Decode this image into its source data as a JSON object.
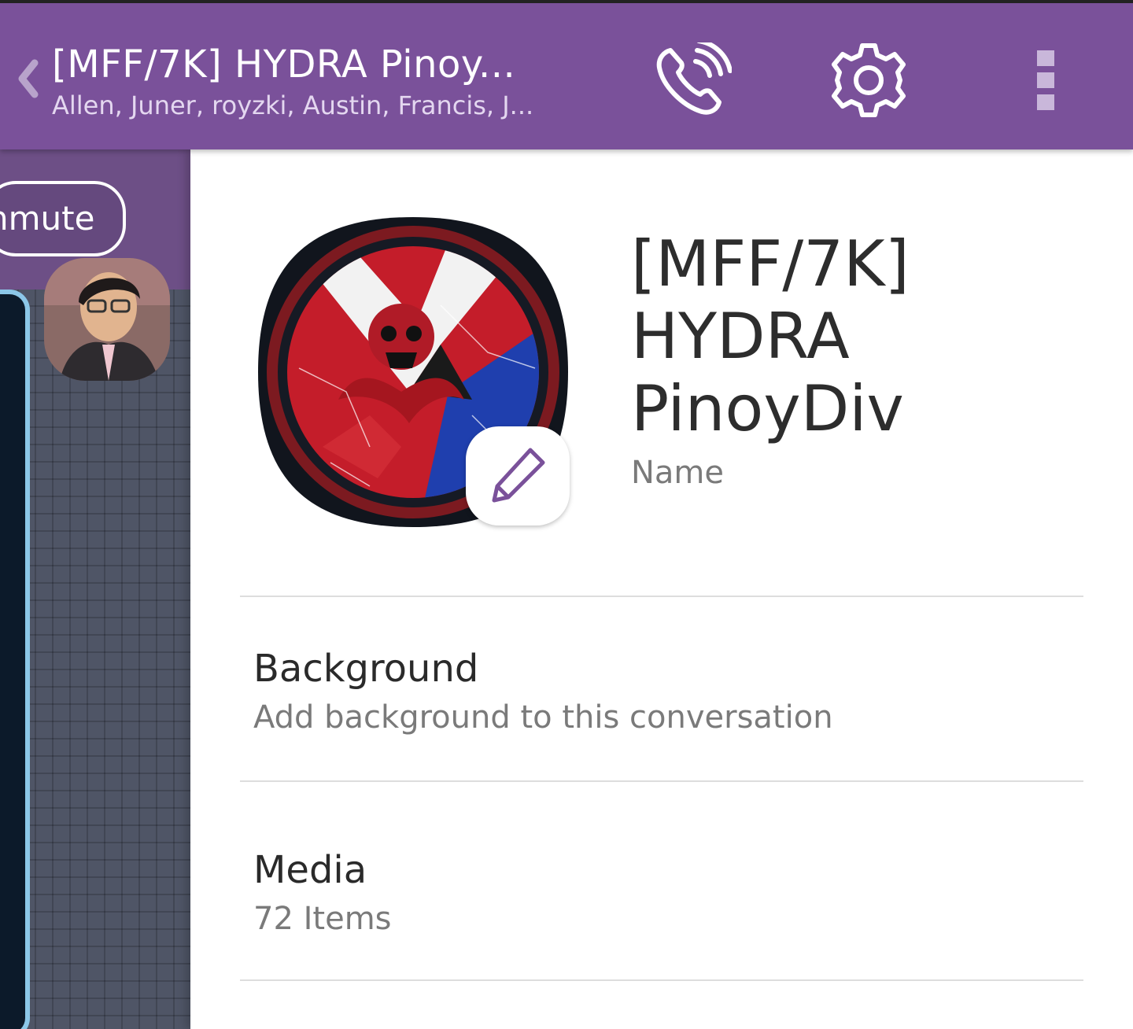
{
  "header": {
    "title": "[MFF/7K] HYDRA Pinoy...",
    "subtitle": "Allen, Juner, royzki, Austin, Francis, J...",
    "icons": [
      "back-chevron-icon",
      "phone-call-icon",
      "gear-icon",
      "more-vertical-icon"
    ]
  },
  "chat": {
    "unmute_label": "nmute"
  },
  "info": {
    "group_name": "[MFF/7K] HYDRA PinoyDiv",
    "name_caption": "Name",
    "background_title": "Background",
    "background_subtitle": "Add background to this conversation",
    "media_title": "Media",
    "media_subtitle": "72 Items"
  },
  "colors": {
    "topbar": "#7a519a",
    "text_primary": "#2a2a2a",
    "text_secondary": "#7a7a7a",
    "accent": "#7a519a"
  }
}
